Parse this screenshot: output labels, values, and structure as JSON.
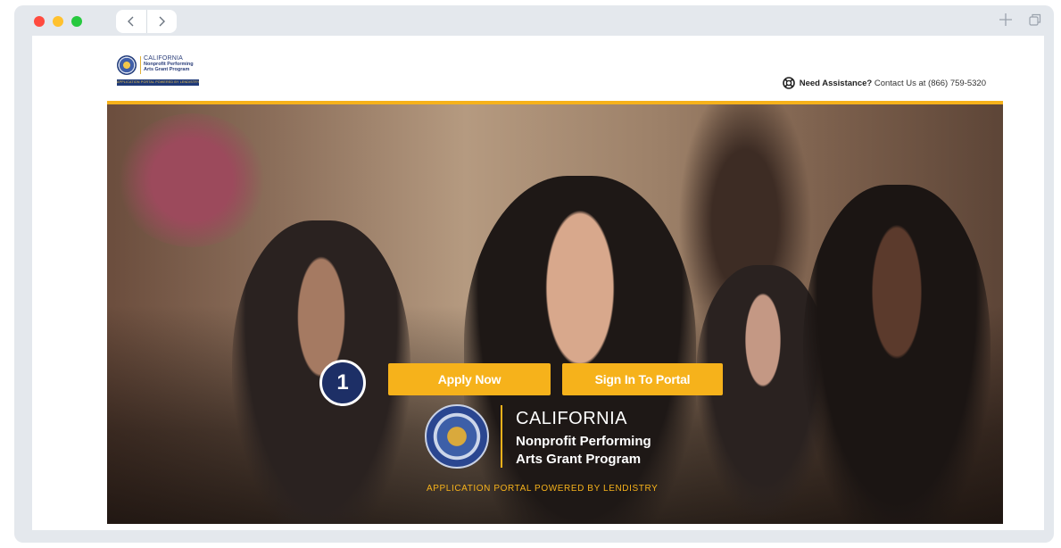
{
  "browser": {
    "nav_back_icon": "chevron-left-icon",
    "nav_forward_icon": "chevron-right-icon",
    "new_tab_icon": "plus-icon",
    "tabs_icon": "tabs-icon"
  },
  "header": {
    "logo": {
      "line1": "CALIFORNIA",
      "line2": "Nonprofit Performing",
      "line3": "Arts Grant Program",
      "bar": "APPLICATION PORTAL POWERED BY LENDISTRY"
    },
    "assistance": {
      "icon": "lifebuoy-icon",
      "bold": "Need Assistance?",
      "text": "Contact Us at (866) 759-5320"
    }
  },
  "hero": {
    "apply_label": "Apply Now",
    "signin_label": "Sign In To Portal",
    "step_badge": "1",
    "title": "CALIFORNIA",
    "subtitle_line1": "Nonprofit Performing",
    "subtitle_line2": "Arts Grant Program",
    "tagline": "APPLICATION PORTAL POWERED BY LENDISTRY"
  },
  "colors": {
    "accent": "#f6b21b",
    "navy": "#1d2f66",
    "chrome": "#e4e8ed"
  }
}
